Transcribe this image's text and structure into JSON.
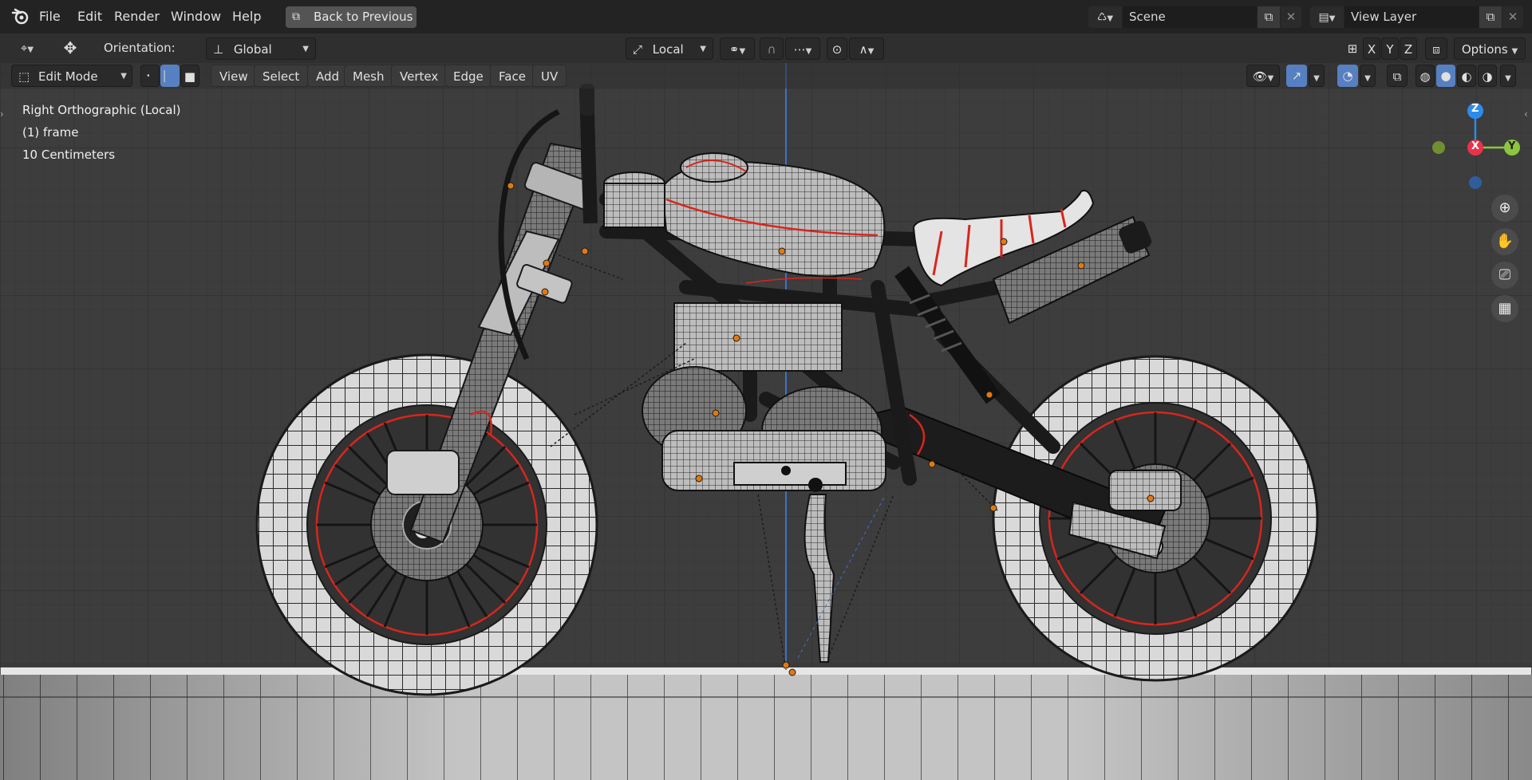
{
  "menu": {
    "file": "File",
    "edit": "Edit",
    "render": "Render",
    "window": "Window",
    "help": "Help",
    "back_to_previous": "Back to Previous"
  },
  "scene": {
    "name": "Scene"
  },
  "view_layer": {
    "name": "View Layer"
  },
  "header": {
    "orientation_label": "Orientation:",
    "orientation_value": "Global",
    "pivot_value": "Local",
    "axes": [
      "X",
      "Y",
      "Z"
    ],
    "options_label": "Options"
  },
  "mode_bar": {
    "mode": "Edit Mode",
    "menus": [
      "View",
      "Select",
      "Add",
      "Mesh",
      "Vertex",
      "Edge",
      "Face",
      "UV"
    ],
    "select_mode_active": "edge"
  },
  "viewport": {
    "view_name": "Right Orthographic (Local)",
    "object_name": "(1) frame",
    "grid_scale": "10 Centimeters"
  },
  "gizmo": {
    "z": "Z",
    "x": "X",
    "y": "Y"
  },
  "colors": {
    "topbar": "#232323",
    "viewport_bg": "#3d3d3d",
    "accent_blue": "#5680c2",
    "axis_x": "#e8334a",
    "axis_y": "#8cc63f",
    "axis_z": "#2d8ceb",
    "seam_red": "#d8261c",
    "vertex_orange": "#e07a10"
  }
}
